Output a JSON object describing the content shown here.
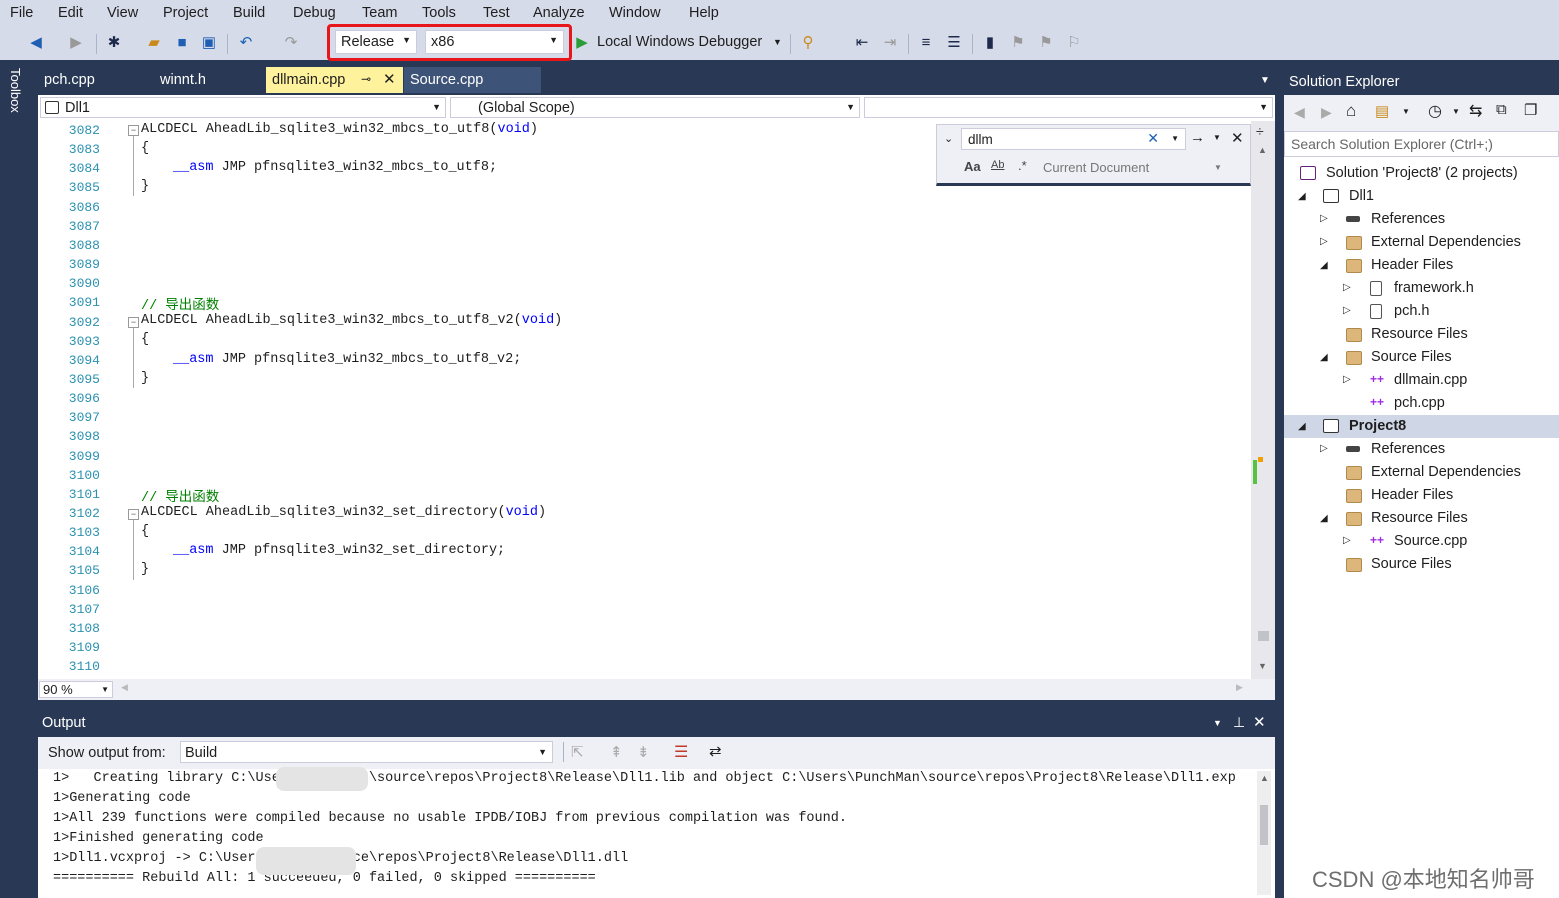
{
  "menu": [
    "File",
    "Edit",
    "View",
    "Project",
    "Build",
    "Debug",
    "Team",
    "Tools",
    "Test",
    "Analyze",
    "Window",
    "Help"
  ],
  "toolbar": {
    "config": "Release",
    "platform": "x86",
    "debugger": "Local Windows Debugger"
  },
  "toolbox_label": "Toolbox",
  "tabs": [
    {
      "label": "pch.cpp"
    },
    {
      "label": "winnt.h"
    },
    {
      "label": "dllmain.cpp",
      "active": true
    },
    {
      "label": "Source.cpp"
    }
  ],
  "navbar": {
    "project": "Dll1",
    "scope": "(Global Scope)"
  },
  "editor": {
    "line_numbers": [
      "3082",
      "3083",
      "3084",
      "3085",
      "3086",
      "3087",
      "3088",
      "3089",
      "3090",
      "3091",
      "3092",
      "3093",
      "3094",
      "3095",
      "3096",
      "3097",
      "3098",
      "3099",
      "3100",
      "3101",
      "3102",
      "3103",
      "3104",
      "3105",
      "3106",
      "3107",
      "3108",
      "3109",
      "3110"
    ],
    "comment_text": "// 导出函数",
    "func1_pre": "ALCDECL AheadLib_sqlite3_win32_mbcs_to_utf8(",
    "func2_pre": "ALCDECL AheadLib_sqlite3_win32_mbcs_to_utf8_v2(",
    "func3_pre": "ALCDECL AheadLib_sqlite3_win32_set_directory(",
    "void_kw": "void",
    "close_paren": ")",
    "open_brace": "{",
    "close_brace": "}",
    "asm_kw": "__asm",
    "body1": " JMP pfnsqlite3_win32_mbcs_to_utf8;",
    "body2": " JMP pfnsqlite3_win32_mbcs_to_utf8_v2;",
    "body3": " JMP pfnsqlite3_win32_set_directory;"
  },
  "find": {
    "query": "dllm",
    "scope": "Current Document",
    "case": "Aa",
    "word": "Ab"
  },
  "zoom": "90 %",
  "output": {
    "title": "Output",
    "show_from_label": "Show output from:",
    "source": "Build",
    "lines": [
      "1>   Creating library C:\\Use           \\source\\repos\\Project8\\Release\\Dll1.lib and object C:\\Users\\PunchMan\\source\\repos\\Project8\\Release\\Dll1.exp",
      "1>Generating code",
      "1>All 239 functions were compiled because no usable IPDB/IOBJ from previous compilation was found.",
      "1>Finished generating code",
      "1>Dll1.vcxproj -> C:\\User          urce\\repos\\Project8\\Release\\Dll1.dll",
      "========== Rebuild All: 1 succeeded, 0 failed, 0 skipped =========="
    ]
  },
  "solution_explorer": {
    "title": "Solution Explorer",
    "search_placeholder": "Search Solution Explorer (Ctrl+;)",
    "nodes": [
      {
        "label": "Solution 'Project8' (2 projects)",
        "type": "solution"
      },
      {
        "label": "Dll1",
        "type": "project"
      },
      {
        "label": "References",
        "type": "ref"
      },
      {
        "label": "External Dependencies",
        "type": "folder"
      },
      {
        "label": "Header Files",
        "type": "folder"
      },
      {
        "label": "framework.h",
        "type": "file"
      },
      {
        "label": "pch.h",
        "type": "file"
      },
      {
        "label": "Resource Files",
        "type": "folder"
      },
      {
        "label": "Source Files",
        "type": "folder"
      },
      {
        "label": "dllmain.cpp",
        "type": "cpp"
      },
      {
        "label": "pch.cpp",
        "type": "cpp"
      },
      {
        "label": "Project8",
        "type": "project"
      },
      {
        "label": "References",
        "type": "ref"
      },
      {
        "label": "External Dependencies",
        "type": "folder"
      },
      {
        "label": "Header Files",
        "type": "folder"
      },
      {
        "label": "Resource Files",
        "type": "folder"
      },
      {
        "label": "Source.cpp",
        "type": "cpp"
      },
      {
        "label": "Source Files",
        "type": "folder"
      }
    ]
  },
  "watermark": "CSDN @本地知名帅哥",
  "colors": {
    "highlight": "#e8151b",
    "active_tab": "#fff29d",
    "chrome": "#293955",
    "line_number": "#2b91af",
    "keyword": "#0000ff",
    "comment": "#008000"
  }
}
